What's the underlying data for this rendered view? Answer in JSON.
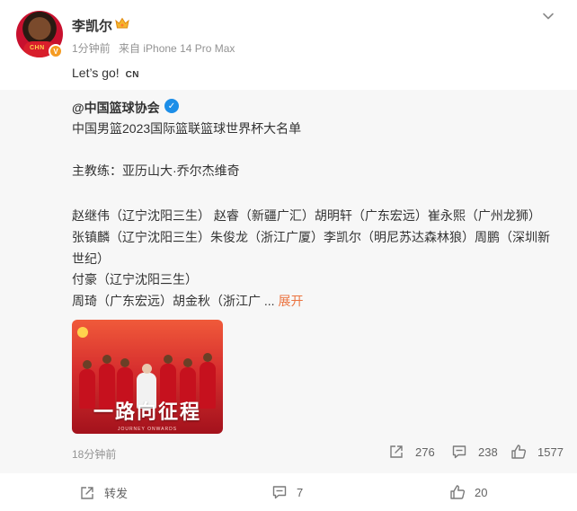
{
  "post": {
    "author": "李凯尔",
    "meta": {
      "time": "1分钟前",
      "source": "来自 iPhone 14 Pro Max"
    },
    "text": "Let’s go!",
    "emoji_text": "CN",
    "avatar_text": "CHN",
    "verified_mark": "V"
  },
  "repost": {
    "author": "@中国篮球协会",
    "verified_mark": "✓",
    "lines": [
      "中国男篮2023国际篮联篮球世界杯大名单",
      "主教练：亚历山大·乔尔杰维奇",
      "赵继伟（辽宁沈阳三生） 赵睿（新疆广汇）胡明轩（广东宏远）崔永熙（广州龙狮）",
      "张镇麟（辽宁沈阳三生）朱俊龙（浙江广厦）李凯尔（明尼苏达森林狼）周鹏（深圳新",
      "世纪）",
      "付豪（辽宁沈阳三生）",
      "周琦（广东宏远）胡金秋（浙江广  ..."
    ],
    "expand_label": "展开",
    "image": {
      "banner": "一路向征程",
      "sub": "JOURNEY  ONWARDS"
    },
    "time": "18分钟前",
    "stats": {
      "reposts": "276",
      "comments": "238",
      "likes": "1577"
    }
  },
  "actions": {
    "share_label": "转发",
    "comments": "7",
    "likes": "20"
  },
  "colors": {
    "accent": "#eb7340",
    "verified_blue": "#1c8ee8",
    "repost_bg": "#f7f7f7"
  }
}
